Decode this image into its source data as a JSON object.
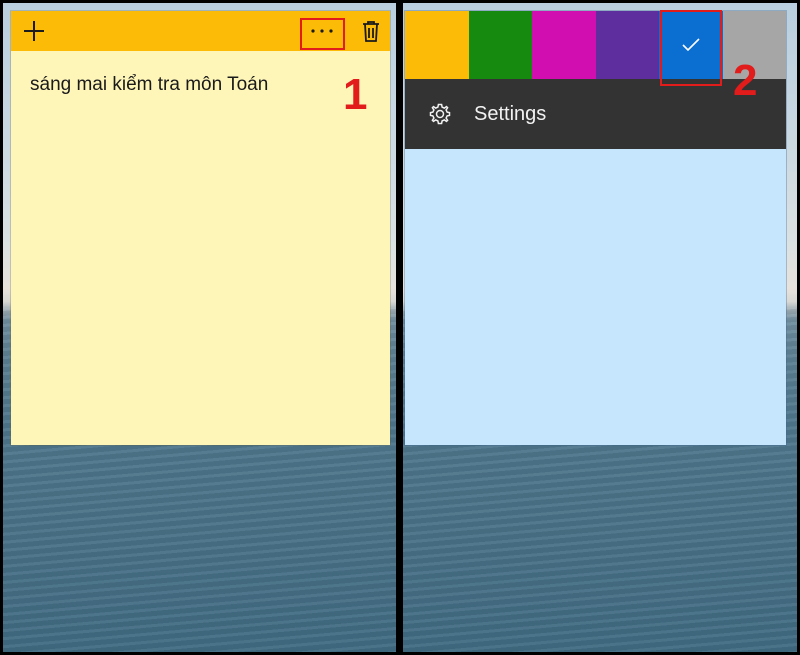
{
  "left_note": {
    "text": "sáng mai kiểm tra môn Toán",
    "titlebar_color": "#fcbb06",
    "body_color": "#fef5b9",
    "icons": [
      "add-icon",
      "more-icon",
      "trash-icon"
    ],
    "step_label": "1"
  },
  "right_note": {
    "body_color": "#c6e6fe",
    "swatches": [
      {
        "name": "yellow",
        "color": "#fcbb06",
        "selected": false
      },
      {
        "name": "green",
        "color": "#168a0e",
        "selected": false
      },
      {
        "name": "pink",
        "color": "#d10fb1",
        "selected": false
      },
      {
        "name": "purple",
        "color": "#5f2e9e",
        "selected": false
      },
      {
        "name": "blue",
        "color": "#0b6fd2",
        "selected": true
      },
      {
        "name": "gray",
        "color": "#a6a6a6",
        "selected": false
      }
    ],
    "settings_label": "Settings",
    "settings_icon": "gear-icon",
    "step_label": "2"
  },
  "highlight_color": "#e21b1b"
}
